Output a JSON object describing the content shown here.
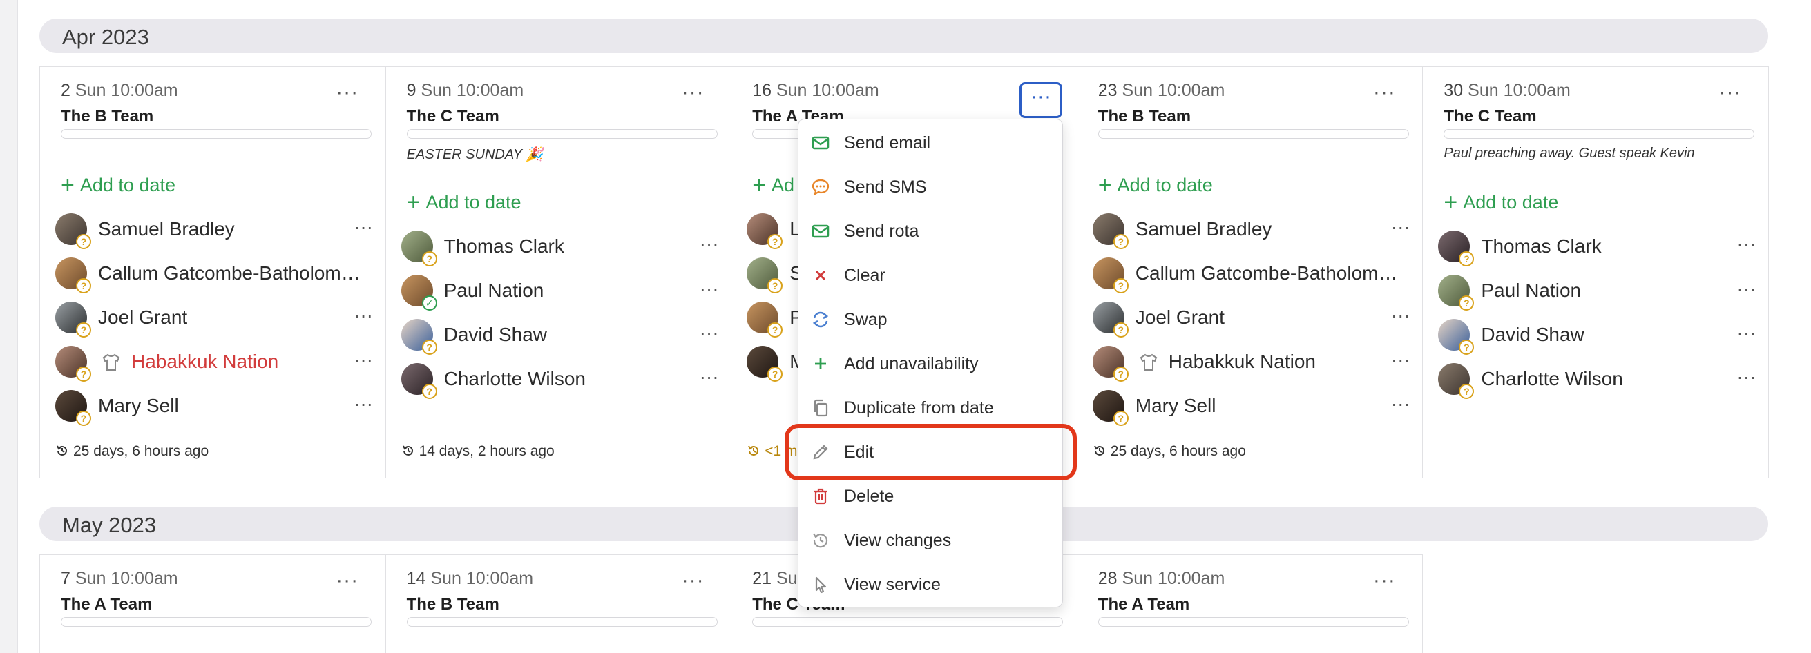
{
  "months": [
    {
      "label": "Apr 2023"
    },
    {
      "label": "May 2023"
    }
  ],
  "apr_cards": [
    {
      "day": "2",
      "time": "Sun 10:00am",
      "team": "The B Team",
      "note": "",
      "add_label": "Add to date",
      "people": [
        {
          "name": "Samuel Bradley",
          "status": "?"
        },
        {
          "name": "Callum Gatcombe-Batholom…",
          "status": "?"
        },
        {
          "name": "Joel Grant",
          "status": "?"
        },
        {
          "name": "Habakkuk Nation",
          "status": "?"
        },
        {
          "name": "Mary Sell",
          "status": "?"
        }
      ],
      "footer": "25 days, 6 hours ago"
    },
    {
      "day": "9",
      "time": "Sun 10:00am",
      "team": "The C Team",
      "note": "EASTER SUNDAY 🎉",
      "add_label": "Add to date",
      "people": [
        {
          "name": "Thomas Clark",
          "status": "?"
        },
        {
          "name": "Paul Nation",
          "status": "✓"
        },
        {
          "name": "David Shaw",
          "status": "?"
        },
        {
          "name": "Charlotte Wilson",
          "status": "?"
        }
      ],
      "footer": "14 days, 2 hours ago"
    },
    {
      "day": "16",
      "time": "Sun 10:00am",
      "team": "The A Team",
      "note": "",
      "add_label": "Ad",
      "people": [
        {
          "name": "L",
          "status": "?"
        },
        {
          "name": "S",
          "status": "?"
        },
        {
          "name": "P",
          "status": "?"
        },
        {
          "name": "M",
          "status": "?"
        }
      ],
      "footer": "<1 m"
    },
    {
      "day": "23",
      "time": "Sun 10:00am",
      "team": "The B Team",
      "note": "",
      "add_label": "Add to date",
      "people": [
        {
          "name": "Samuel Bradley",
          "status": "?"
        },
        {
          "name": "Callum Gatcombe-Batholom…",
          "status": "?"
        },
        {
          "name": "Joel Grant",
          "status": "?"
        },
        {
          "name": "Habakkuk Nation",
          "status": "?"
        },
        {
          "name": "Mary Sell",
          "status": "?"
        }
      ],
      "footer": "25 days, 6 hours ago"
    },
    {
      "day": "30",
      "time": "Sun 10:00am",
      "team": "The C Team",
      "note": "Paul preaching away. Guest speak Kevin",
      "add_label": "Add to date",
      "people": [
        {
          "name": "Thomas Clark",
          "status": "?"
        },
        {
          "name": "Paul Nation",
          "status": "?"
        },
        {
          "name": "David Shaw",
          "status": "?"
        },
        {
          "name": "Charlotte Wilson",
          "status": "?"
        }
      ],
      "footer": ""
    }
  ],
  "may_cards": [
    {
      "day": "7",
      "time": "Sun 10:00am",
      "team": "The A Team"
    },
    {
      "day": "14",
      "time": "Sun 10:00am",
      "team": "The B Team"
    },
    {
      "day": "21",
      "time": "Su",
      "team": "The C Team"
    },
    {
      "day": "28",
      "time": "Sun 10:00am",
      "team": "The A Team"
    }
  ],
  "more_glyph": "···",
  "menu": {
    "items": [
      {
        "label": "Send email",
        "icon": "envelope-icon"
      },
      {
        "label": "Send SMS",
        "icon": "speech-bubble-icon"
      },
      {
        "label": "Send rota",
        "icon": "envelope-icon"
      },
      {
        "label": "Clear",
        "icon": "x-icon"
      },
      {
        "label": "Swap",
        "icon": "swap-icon"
      },
      {
        "label": "Add unavailability",
        "icon": "plus-icon"
      },
      {
        "label": "Duplicate from date",
        "icon": "copy-icon"
      },
      {
        "label": "Edit",
        "icon": "pencil-icon"
      },
      {
        "label": "Delete",
        "icon": "trash-icon"
      },
      {
        "label": "View changes",
        "icon": "history-icon"
      },
      {
        "label": "View service",
        "icon": "pointer-icon"
      }
    ]
  },
  "colors": {
    "accent_green": "#2e9e50",
    "danger_red": "#d23c3c",
    "active_blue": "#2c5ec6",
    "highlight_red": "#e2371a",
    "sms_orange": "#e8862a",
    "pending_yellow": "#d9a21b"
  }
}
